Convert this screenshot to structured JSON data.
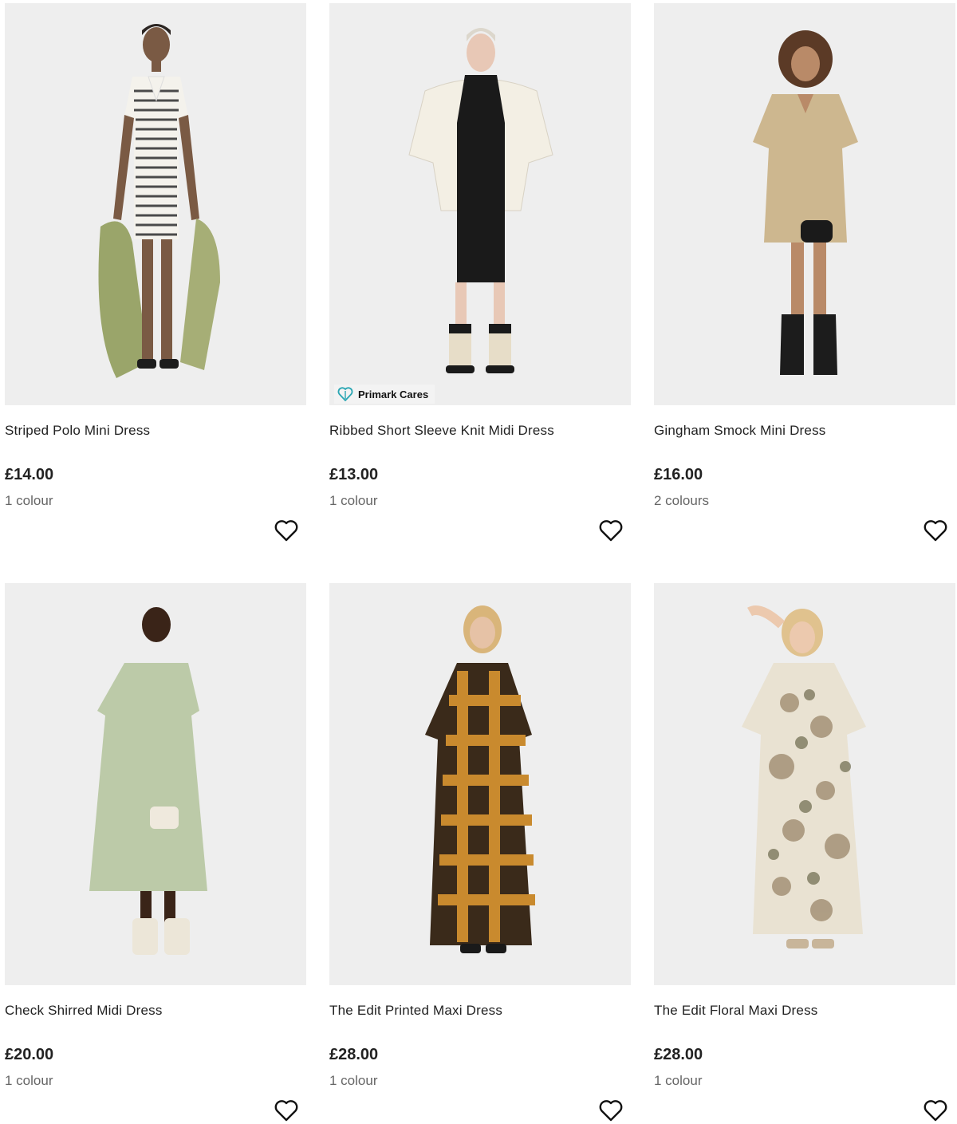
{
  "products": [
    {
      "name": "Striped Polo Mini Dress",
      "price": "£14.00",
      "colours": "1 colour",
      "favourite_icon": "heart-outline-icon"
    },
    {
      "name": "Ribbed Short Sleeve Knit Midi Dress",
      "price": "£13.00",
      "colours": "1 colour",
      "favourite_icon": "heart-outline-icon",
      "badge": {
        "label": "Primark Cares",
        "icon": "heart-leaf-icon",
        "color": "#2aa6b3"
      }
    },
    {
      "name": "Gingham Smock Mini Dress",
      "price": "£16.00",
      "colours": "2 colours",
      "favourite_icon": "heart-outline-icon"
    },
    {
      "name": "Check Shirred Midi Dress",
      "price": "£20.00",
      "colours": "1 colour",
      "favourite_icon": "heart-outline-icon"
    },
    {
      "name": "The Edit Printed Maxi Dress",
      "price": "£28.00",
      "colours": "1 colour",
      "favourite_icon": "heart-outline-icon"
    },
    {
      "name": "The Edit Floral Maxi Dress",
      "price": "£28.00",
      "colours": "1 colour",
      "favourite_icon": "heart-outline-icon"
    }
  ],
  "colors": {
    "image_background": "#eeeeee",
    "text": "#222222",
    "muted": "#666666"
  }
}
